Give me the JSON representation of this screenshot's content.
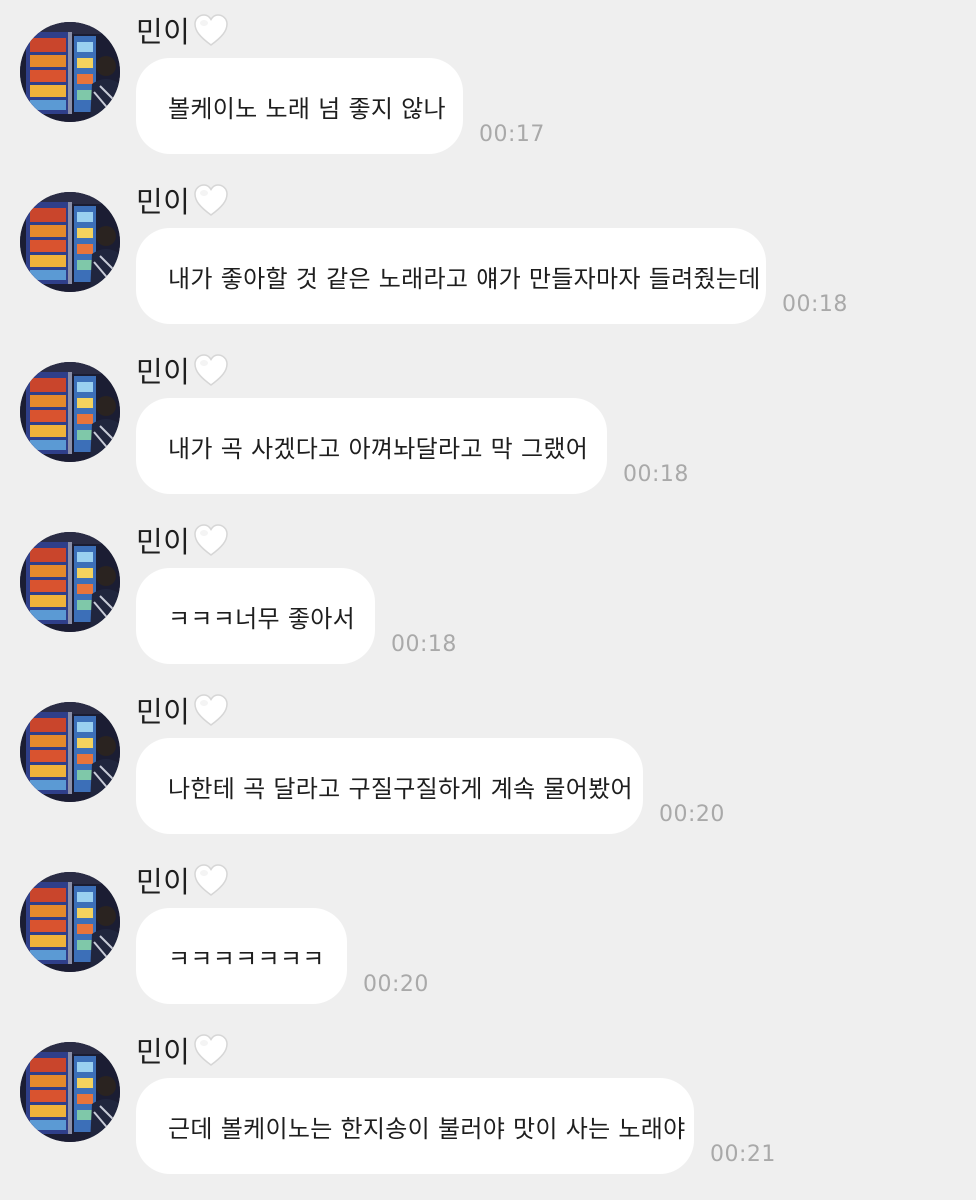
{
  "chat": {
    "sender_name": "민이",
    "heart_icon": "white-heart-icon",
    "avatar_icon": "profile-photo",
    "colors": {
      "background": "#efefef",
      "bubble": "#ffffff",
      "text": "#1e1e1e",
      "timestamp": "#a9a9a9"
    },
    "messages": [
      {
        "text": "볼케이노 노래 넘 좋지 않나",
        "time": "00:17"
      },
      {
        "text": "내가 좋아할 것 같은 노래라고 얘가 만들자마자 들려줬는데",
        "time": "00:18"
      },
      {
        "text": "내가 곡 사겠다고 아껴놔달라고 막 그랬어",
        "time": "00:18"
      },
      {
        "text": "ㅋㅋㅋ너무 좋아서",
        "time": "00:18"
      },
      {
        "text": "나한테 곡 달라고 구질구질하게 계속 물어봤어",
        "time": "00:20"
      },
      {
        "text": "ㅋㅋㅋㅋㅋㅋㅋ",
        "time": "00:20"
      },
      {
        "text": "근데 볼케이노는 한지송이 불러야 맛이 사는 노래야",
        "time": "00:21"
      }
    ]
  }
}
